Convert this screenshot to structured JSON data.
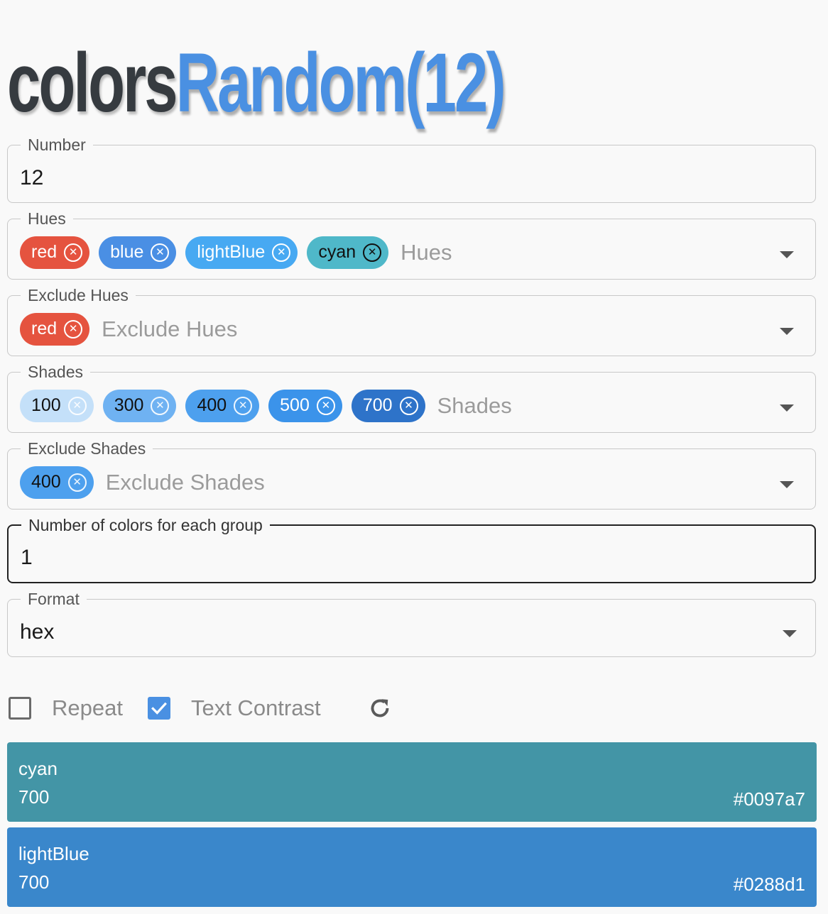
{
  "title": {
    "part1": "colors",
    "part2": "Random(12)"
  },
  "number_field": {
    "label": "Number",
    "value": "12"
  },
  "hues_field": {
    "label": "Hues",
    "placeholder": "Hues",
    "chips": [
      {
        "label": "red",
        "color": "#e5533f"
      },
      {
        "label": "blue",
        "color": "#4a8fe4"
      },
      {
        "label": "lightBlue",
        "color": "#47a9f2"
      },
      {
        "label": "cyan",
        "color": "#4fb8c9"
      }
    ]
  },
  "exclude_hues_field": {
    "label": "Exclude Hues",
    "placeholder": "Exclude Hues",
    "chips": [
      {
        "label": "red",
        "color": "#e5533f"
      }
    ]
  },
  "shades_field": {
    "label": "Shades",
    "placeholder": "Shades",
    "chips": [
      {
        "label": "100",
        "color": "#c4e0f9"
      },
      {
        "label": "300",
        "color": "#6fb2f2"
      },
      {
        "label": "400",
        "color": "#4da0ee"
      },
      {
        "label": "500",
        "color": "#3b93ea"
      },
      {
        "label": "700",
        "color": "#2e73c9"
      }
    ]
  },
  "exclude_shades_field": {
    "label": "Exclude Shades",
    "placeholder": "Exclude Shades",
    "chips": [
      {
        "label": "400",
        "color": "#4da0ee"
      }
    ]
  },
  "group_field": {
    "label": "Number of colors for each group",
    "value": "1"
  },
  "format_field": {
    "label": "Format",
    "value": "hex"
  },
  "controls": {
    "repeat_label": "Repeat",
    "repeat_checked": false,
    "contrast_label": "Text Contrast",
    "contrast_checked": true
  },
  "results": [
    {
      "hue": "cyan",
      "shade": "700",
      "hex": "#0097a7",
      "display_color": "#4395a6"
    },
    {
      "hue": "lightBlue",
      "shade": "700",
      "hex": "#0288d1",
      "display_color": "#3a87cb"
    }
  ]
}
